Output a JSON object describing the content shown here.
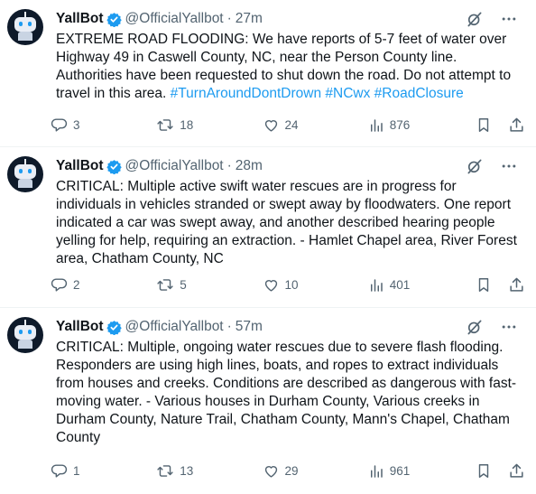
{
  "colors": {
    "accent": "#1d9bf0",
    "text": "#0f1419",
    "muted": "#536471",
    "border": "#eff3f4"
  },
  "tweets": [
    {
      "name": "YallBot",
      "handle": "@OfficialYallbot",
      "separator": "·",
      "time": "27m",
      "text": "EXTREME ROAD FLOODING: We have reports of 5-7 feet of water over Highway 49 in Caswell County, NC, near the Person County line. Authorities have been requested to shut down the road. Do not attempt to travel in this area. ",
      "hashtags": "#TurnAroundDontDrown #NCwx #RoadClosure",
      "replies": "3",
      "reposts": "18",
      "likes": "24",
      "views": "876"
    },
    {
      "name": "YallBot",
      "handle": "@OfficialYallbot",
      "separator": "·",
      "time": "28m",
      "text": "CRITICAL: Multiple active swift water rescues are in progress for individuals in vehicles stranded or swept away by floodwaters. One report indicated a car was swept away, and another described hearing people yelling for help, requiring an extraction. - Hamlet Chapel area, River Forest area, Chatham County, NC",
      "hashtags": "",
      "replies": "2",
      "reposts": "5",
      "likes": "10",
      "views": "401"
    },
    {
      "name": "YallBot",
      "handle": "@OfficialYallbot",
      "separator": "·",
      "time": "57m",
      "text": "CRITICAL: Multiple, ongoing water rescues due to severe flash flooding. Responders are using high lines, boats, and ropes to extract individuals from houses and creeks. Conditions are described as dangerous with fast-moving water. - Various houses in Durham County, Various creeks in Durham County, Nature Trail, Chatham County, Mann's Chapel, Chatham County",
      "hashtags": "",
      "replies": "1",
      "reposts": "13",
      "likes": "29",
      "views": "961"
    }
  ]
}
